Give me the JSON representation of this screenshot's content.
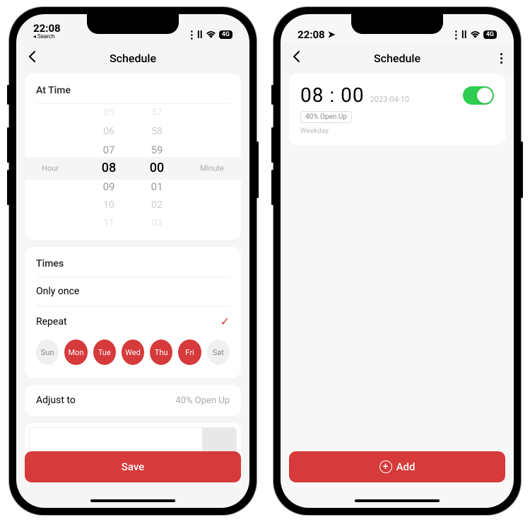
{
  "left": {
    "status": {
      "time": "22:08",
      "search": "◂ Search",
      "network": "4G"
    },
    "nav": {
      "title": "Schedule"
    },
    "at_time": {
      "title": "At Time",
      "hour_label": "Hour",
      "minute_label": "Minute",
      "hours": [
        "05",
        "06",
        "07",
        "08",
        "09",
        "10",
        "11"
      ],
      "minutes": [
        "57",
        "58",
        "59",
        "00",
        "01",
        "02",
        "03"
      ],
      "selected_hour": "08",
      "selected_minute": "00"
    },
    "times": {
      "title": "Times",
      "only_once": "Only once",
      "repeat": "Repeat",
      "days": [
        {
          "label": "Sun",
          "active": false
        },
        {
          "label": "Mon",
          "active": true
        },
        {
          "label": "Tue",
          "active": true
        },
        {
          "label": "Wed",
          "active": true
        },
        {
          "label": "Thu",
          "active": true
        },
        {
          "label": "Fri",
          "active": true
        },
        {
          "label": "Sat",
          "active": false
        }
      ]
    },
    "adjust": {
      "title": "Adjust to",
      "value": "40% Open Up"
    },
    "save": "Save"
  },
  "right": {
    "status": {
      "time": "22:08",
      "network": "4G"
    },
    "nav": {
      "title": "Schedule"
    },
    "item": {
      "time": "08 : 00",
      "date": "2023-04-10",
      "badge": "40% Open Up",
      "sub": "Weekday",
      "enabled": true
    },
    "add": "Add"
  }
}
